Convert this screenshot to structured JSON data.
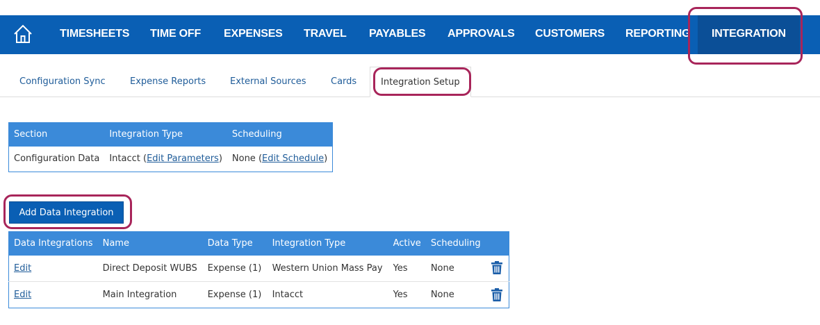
{
  "nav": {
    "home_icon": "home-icon",
    "items": [
      {
        "label": "TIMESHEETS"
      },
      {
        "label": "TIME OFF"
      },
      {
        "label": "EXPENSES"
      },
      {
        "label": "TRAVEL"
      },
      {
        "label": "PAYABLES"
      },
      {
        "label": "APPROVALS"
      },
      {
        "label": "CUSTOMERS"
      },
      {
        "label": "REPORTING"
      },
      {
        "label": "INTEGRATION"
      }
    ],
    "active": "INTEGRATION"
  },
  "subtabs": {
    "items": [
      {
        "label": "Configuration Sync"
      },
      {
        "label": "Expense Reports"
      },
      {
        "label": "External Sources"
      },
      {
        "label": "Cards"
      },
      {
        "label": "Integration Setup"
      }
    ],
    "active": "Integration Setup"
  },
  "config_table": {
    "headers": [
      "Section",
      "Integration Type",
      "Scheduling"
    ],
    "row": {
      "section": "Configuration Data",
      "integration_type": "Intacct",
      "edit_parameters": "Edit Parameters",
      "scheduling": "None",
      "edit_schedule": "Edit Schedule"
    }
  },
  "add_button": {
    "label": "Add Data Integration"
  },
  "integrations_table": {
    "headers": [
      "Data Integrations",
      "Name",
      "Data Type",
      "Integration Type",
      "Active",
      "Scheduling"
    ],
    "rows": [
      {
        "edit": "Edit",
        "name": "Direct Deposit WUBS",
        "data_type": "Expense (1)",
        "integration_type": "Western Union Mass Pay",
        "active": "Yes",
        "scheduling": "None"
      },
      {
        "edit": "Edit",
        "name": "Main Integration",
        "data_type": "Expense (1)",
        "integration_type": "Intacct",
        "active": "Yes",
        "scheduling": "None"
      }
    ],
    "delete_icon": "trash-icon"
  },
  "colors": {
    "nav_bg": "#0a5fb4",
    "nav_active_bg": "#0b4f97",
    "header_bg": "#3b8ad9",
    "link": "#1f5c99",
    "highlight": "#a8255a"
  }
}
